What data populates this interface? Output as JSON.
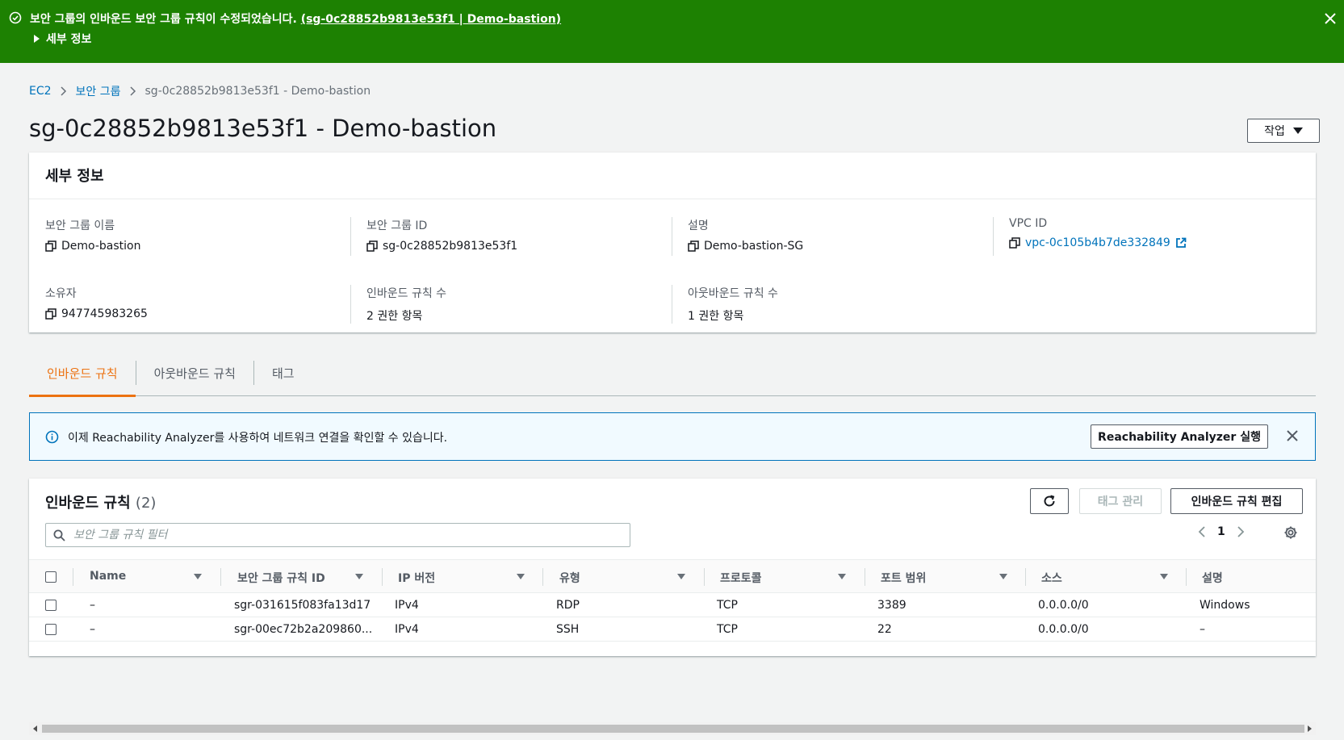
{
  "flash": {
    "message": "보안 그룹의 인바운드 보안 그룹 규칙이 수정되었습니다.",
    "link": "(sg-0c28852b9813e53f1 | Demo-bastion)",
    "details_label": "세부 정보",
    "color": "#1d8102"
  },
  "breadcrumb": {
    "items": [
      "EC2",
      "보안 그룹"
    ],
    "current": "sg-0c28852b9813e53f1 - Demo-bastion"
  },
  "page": {
    "title": "sg-0c28852b9813e53f1 - Demo-bastion",
    "actions_label": "작업"
  },
  "details": {
    "header": "세부 정보",
    "fields": [
      {
        "label": "보안 그룹 이름",
        "value": "Demo-bastion"
      },
      {
        "label": "보안 그룹 ID",
        "value": "sg-0c28852b9813e53f1"
      },
      {
        "label": "설명",
        "value": "Demo-bastion-SG"
      },
      {
        "label": "VPC ID",
        "value": "vpc-0c105b4b7de332849"
      },
      {
        "label": "소유자",
        "value": "947745983265"
      },
      {
        "label": "인바운드 규칙 수",
        "value": "2 권한 항목"
      },
      {
        "label": "아웃바운드 규칙 수",
        "value": "1 권한 항목"
      }
    ]
  },
  "tabs": [
    {
      "label": "인바운드 규칙",
      "active": true
    },
    {
      "label": "아웃바운드 규칙",
      "active": false
    },
    {
      "label": "태그",
      "active": false
    }
  ],
  "info_alert": {
    "text": "이제 Reachability Analyzer를 사용하여 네트워크 연결을 확인할 수 있습니다.",
    "button": "Reachability Analyzer 실행"
  },
  "rules": {
    "title": "인바운드 규칙",
    "count": "(2)",
    "tags_button": "태그 관리",
    "edit_button": "인바운드 규칙 편집",
    "search_placeholder": "보안 그룹 규칙 필터",
    "page": "1",
    "columns": [
      "Name",
      "보안 그룹 규칙 ID",
      "IP 버전",
      "유형",
      "프로토콜",
      "포트 범위",
      "소스",
      "설명"
    ],
    "rows": [
      [
        "–",
        "sgr-031615f083fa13d17",
        "IPv4",
        "RDP",
        "TCP",
        "3389",
        "0.0.0.0/0",
        "Windows"
      ],
      [
        "–",
        "sgr-00ec72b2a209860...",
        "IPv4",
        "SSH",
        "TCP",
        "22",
        "0.0.0.0/0",
        "–"
      ]
    ]
  },
  "colors": {
    "accent": "#ec7211",
    "link": "#0073bb",
    "success": "#1d8102"
  },
  "icons": [
    "success-check-icon",
    "close-icon",
    "copy-icon",
    "external-link-icon",
    "info-icon",
    "refresh-icon",
    "search-icon",
    "chevron-left-icon",
    "chevron-right-icon",
    "gear-icon",
    "sort-caret-icon"
  ]
}
